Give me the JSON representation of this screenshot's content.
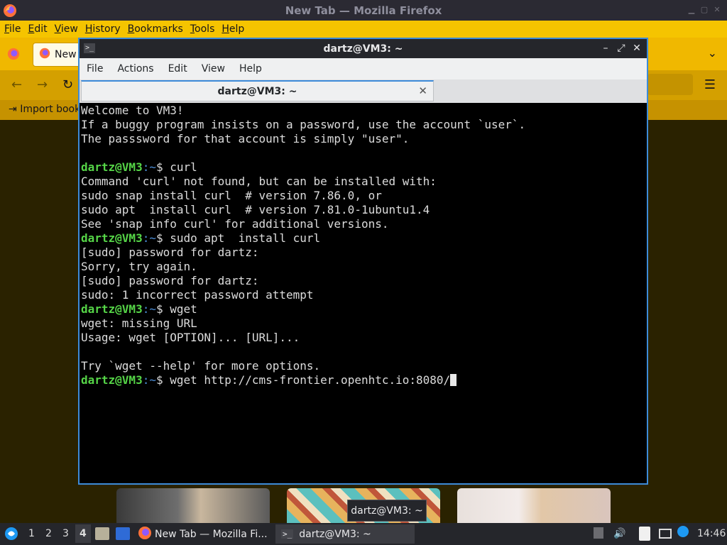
{
  "firefox": {
    "window_title": "New Tab — Mozilla Firefox",
    "menu": [
      {
        "label": "File",
        "accel": "F",
        "rest": "ile"
      },
      {
        "label": "Edit",
        "accel": "E",
        "rest": "dit"
      },
      {
        "label": "View",
        "accel": "V",
        "rest": "iew"
      },
      {
        "label": "History",
        "accel": "H",
        "rest": "istory"
      },
      {
        "label": "Bookmarks",
        "accel": "B",
        "rest": "ookmarks"
      },
      {
        "label": "Tools",
        "accel": "T",
        "rest": "ools"
      },
      {
        "label": "Help",
        "accel": "H",
        "rest": "elp"
      }
    ],
    "tab_label": "New",
    "bookmarks_import": "Import book"
  },
  "terminal": {
    "window_title": "dartz@VM3: ~",
    "menu": [
      "File",
      "Actions",
      "Edit",
      "View",
      "Help"
    ],
    "tab_label": "dartz@VM3: ~",
    "prompt_user": "dartz@VM3",
    "prompt_path": ":~",
    "lines": [
      {
        "type": "out",
        "text": "Welcome to VM3!"
      },
      {
        "type": "out",
        "text": "If a buggy program insists on a password, use the account `user`."
      },
      {
        "type": "out",
        "text": "The passsword for that account is simply \"user\"."
      },
      {
        "type": "out",
        "text": ""
      },
      {
        "type": "cmd",
        "text": "$ curl"
      },
      {
        "type": "out",
        "text": "Command 'curl' not found, but can be installed with:"
      },
      {
        "type": "out",
        "text": "sudo snap install curl  # version 7.86.0, or"
      },
      {
        "type": "out",
        "text": "sudo apt  install curl  # version 7.81.0-1ubuntu1.4"
      },
      {
        "type": "out",
        "text": "See 'snap info curl' for additional versions."
      },
      {
        "type": "cmd",
        "text": "$ sudo apt  install curl"
      },
      {
        "type": "out",
        "text": "[sudo] password for dartz:"
      },
      {
        "type": "out",
        "text": "Sorry, try again."
      },
      {
        "type": "out",
        "text": "[sudo] password for dartz:"
      },
      {
        "type": "out",
        "text": "sudo: 1 incorrect password attempt"
      },
      {
        "type": "cmd",
        "text": "$ wget"
      },
      {
        "type": "out",
        "text": "wget: missing URL"
      },
      {
        "type": "out",
        "text": "Usage: wget [OPTION]... [URL]..."
      },
      {
        "type": "out",
        "text": ""
      },
      {
        "type": "out",
        "text": "Try `wget --help' for more options."
      },
      {
        "type": "cmd",
        "text": "$ wget http://cms-frontier.openhtc.io:8080/",
        "cursor": true
      }
    ]
  },
  "tooltip": "dartz@VM3: ~",
  "taskbar": {
    "workspaces": [
      "1",
      "2",
      "3",
      "4"
    ],
    "active_workspace": "4",
    "firefox_task": "New Tab — Mozilla Fi...",
    "terminal_task": "dartz@VM3: ~",
    "clock": "14:46"
  },
  "colors": {
    "firefox_yellow": "#f5c400",
    "terminal_prompt_user": "#55d447",
    "terminal_prompt_path": "#4d8fd9",
    "focus_border": "#3d8bd9"
  }
}
